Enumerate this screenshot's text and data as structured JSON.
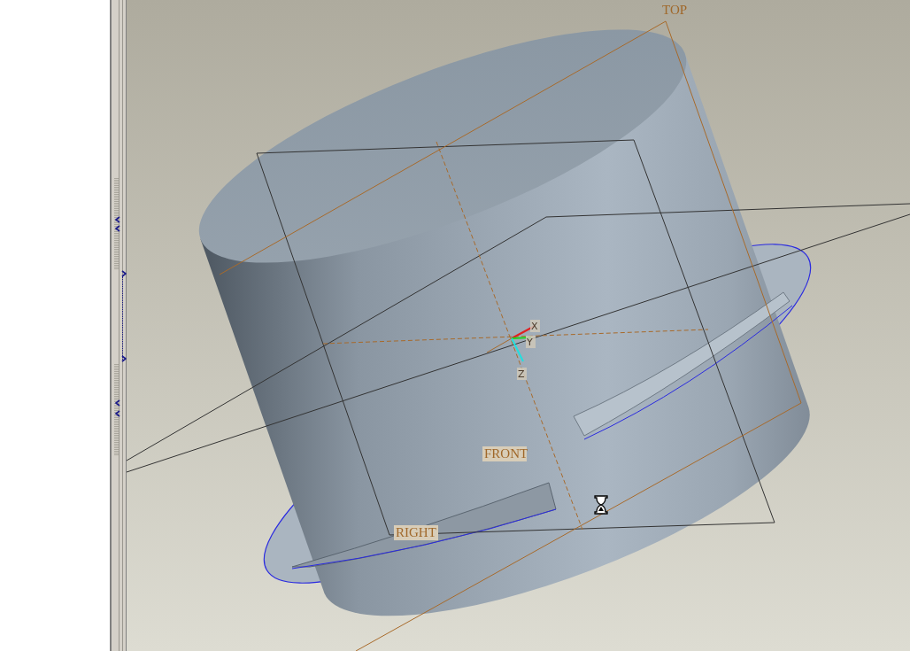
{
  "datum_planes": [
    {
      "label": "TOP"
    },
    {
      "label": "FRONT"
    },
    {
      "label": "RIGHT"
    }
  ],
  "coordinate_system": {
    "axes": [
      "X",
      "Y",
      "Z"
    ]
  }
}
